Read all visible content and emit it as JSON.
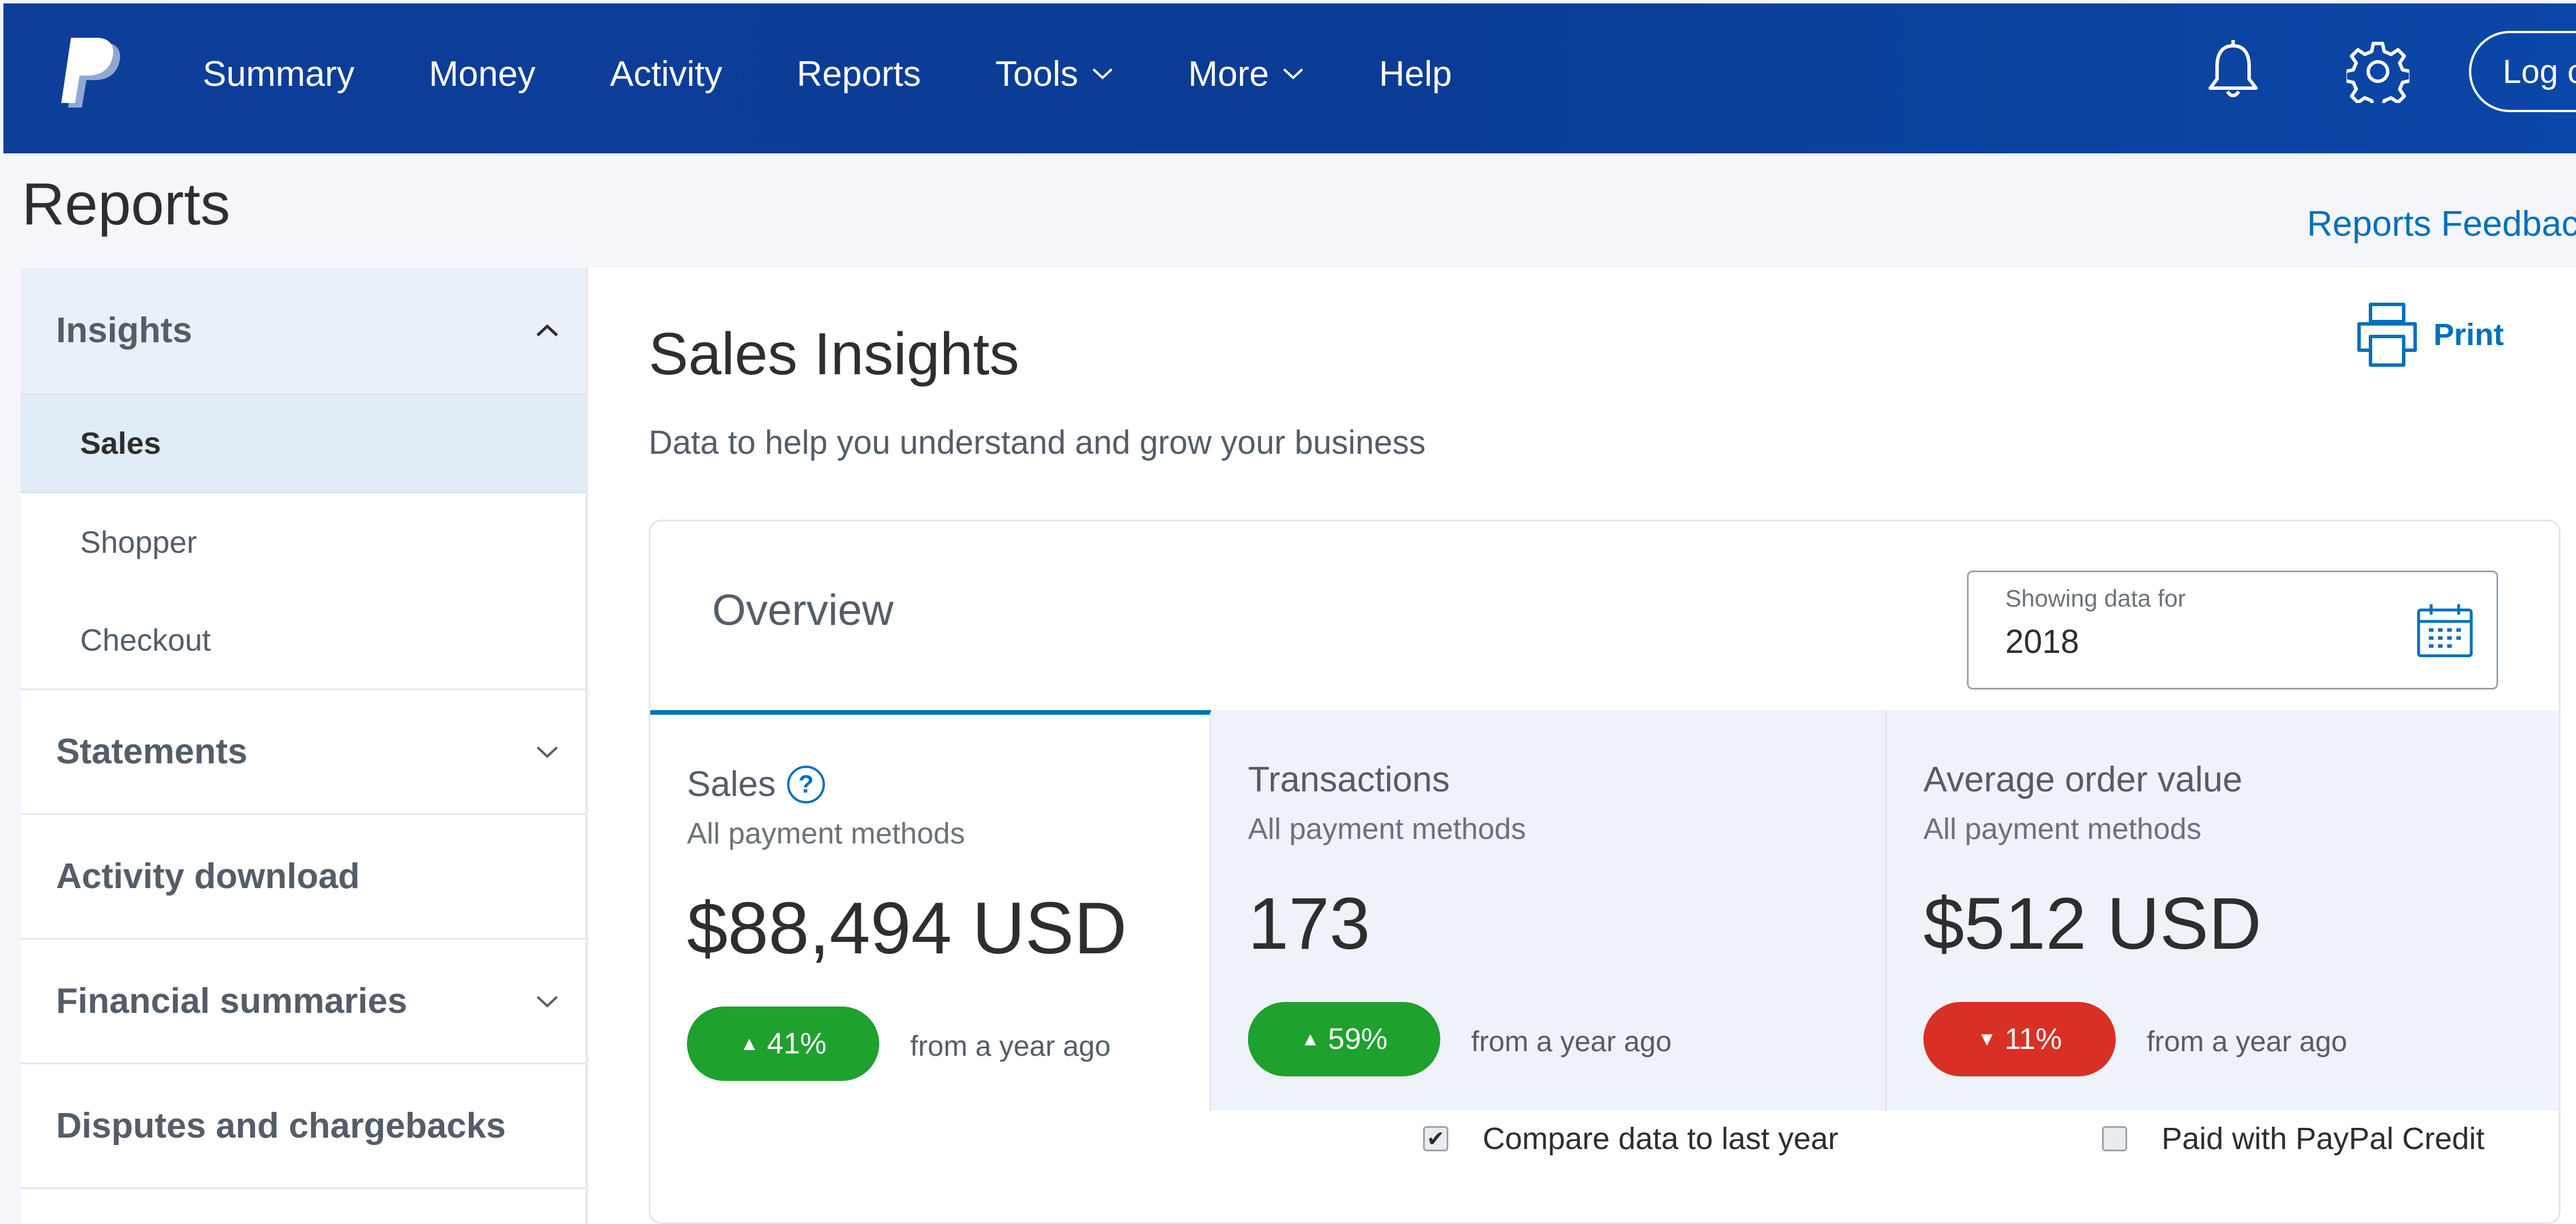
{
  "nav": {
    "items": [
      {
        "label": "Summary"
      },
      {
        "label": "Money"
      },
      {
        "label": "Activity"
      },
      {
        "label": "Reports"
      },
      {
        "label": "Tools",
        "has_dropdown": true
      },
      {
        "label": "More",
        "has_dropdown": true
      },
      {
        "label": "Help"
      }
    ],
    "logout_label": "Log o",
    "icons": [
      "paypal-logo",
      "bell-icon",
      "gear-icon"
    ],
    "background_color": "#0b3e99"
  },
  "header": {
    "title": "Reports",
    "feedback_link": "Reports Feedback"
  },
  "sidebar": {
    "sections": [
      {
        "label": "Insights",
        "expanded": true,
        "sub_items": [
          {
            "label": "Sales",
            "selected": true
          },
          {
            "label": "Shopper"
          },
          {
            "label": "Checkout"
          }
        ]
      },
      {
        "label": "Statements",
        "expanded": false
      },
      {
        "label": "Activity download"
      },
      {
        "label": "Financial summaries",
        "expanded": false
      },
      {
        "label": "Disputes and chargebacks"
      }
    ]
  },
  "main": {
    "title": "Sales Insights",
    "subtitle": "Data to help you understand and grow your business",
    "print_label": "Print",
    "overview": {
      "title": "Overview",
      "date_label": "Showing data for",
      "date_value": "2018",
      "metrics": [
        {
          "title": "Sales",
          "sub": "All payment methods",
          "value": "$88,494 USD",
          "change": "41%",
          "direction": "up",
          "from": "from a year ago",
          "active": true
        },
        {
          "title": "Transactions",
          "sub": "All payment methods",
          "value": "173",
          "change": "59%",
          "direction": "up",
          "from": "from a year ago"
        },
        {
          "title": "Average order value",
          "sub": "All payment methods",
          "value": "$512 USD",
          "change": "11%",
          "direction": "down",
          "from": "from a year ago"
        }
      ],
      "compare_label": "Compare data to last year",
      "compare_checked": true,
      "credit_label": "Paid with PayPal Credit",
      "credit_checked": false
    }
  },
  "colors": {
    "accent": "#0070ba",
    "positive": "#1ea12d",
    "negative": "#d93025"
  }
}
